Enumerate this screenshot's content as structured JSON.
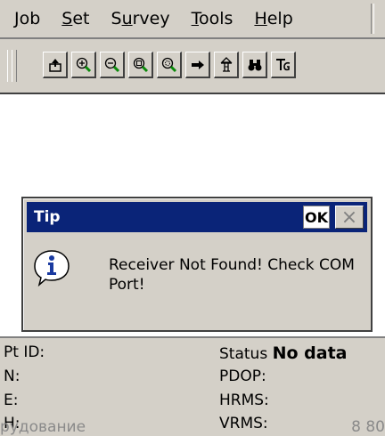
{
  "menu": {
    "items": [
      {
        "first": "J",
        "rest": "ob"
      },
      {
        "first": "S",
        "rest": "et"
      },
      {
        "first": "S",
        "mid": "u",
        "rest": "rvey"
      },
      {
        "first": "T",
        "rest": "ools"
      },
      {
        "first": "H",
        "rest": "elp"
      }
    ]
  },
  "toolbar": {
    "buttons": [
      "export-icon",
      "zoom-in-icon",
      "zoom-out-icon",
      "zoom-window-icon",
      "zoom-extents-icon",
      "arrow-right-icon",
      "tower-icon",
      "binoculars-icon",
      "text-tool-icon"
    ]
  },
  "dialog": {
    "title": "Tip",
    "ok_label": "OK",
    "close_label": "×",
    "message": "Receiver Not Found! Check COM Port!"
  },
  "status": {
    "pt_id_label": "Pt ID:",
    "n_label": "N:",
    "e_label": "E:",
    "h_label": "H:",
    "status_label": "Status",
    "status_value": "No data",
    "pdop_label": "PDOP:",
    "hrms_label": "HRMS:",
    "vrms_label": "VRMS:"
  },
  "overlay": {
    "left_text": "рудование",
    "right_text": "8 80"
  },
  "colors": {
    "titlebar": "#0a2478",
    "chrome": "#d4d0c8"
  }
}
